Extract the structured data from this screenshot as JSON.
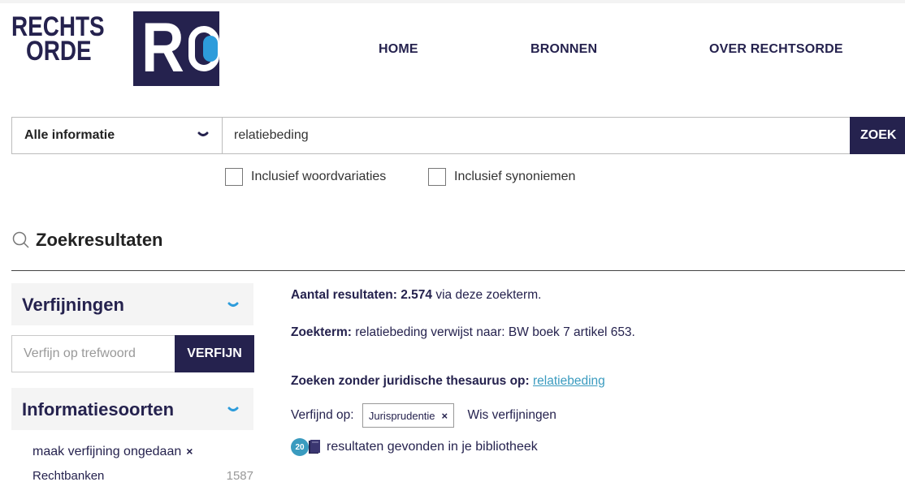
{
  "logo": {
    "line1": "RECHTS",
    "line2": "ORDE",
    "mark": "R"
  },
  "nav": {
    "home": "HOME",
    "bronnen": "BRONNEN",
    "over": "OVER RECHTSORDE"
  },
  "search": {
    "scope": "Alle informatie",
    "query": "relatiebeding",
    "submit": "ZOEK",
    "options": [
      {
        "label": "Inclusief woordvariaties",
        "checked": false
      },
      {
        "label": "Inclusief synoniemen",
        "checked": false
      }
    ]
  },
  "results": {
    "title": "Zoekresultaten",
    "count_label": "Aantal resultaten:",
    "count_value": "2.574",
    "count_suffix": " via deze zoekterm.",
    "term_label": "Zoekterm:",
    "term_text": " relatiebeding verwijst naar: BW boek 7 artikel 653.",
    "thesaurus_label": "Zoeken zonder juridische thesaurus op:",
    "thesaurus_link": "relatiebeding",
    "refined_label": "Verfijnd op:",
    "refined_chip": "Jurisprudentie",
    "chip_remove": "×",
    "clear_refinements": "Wis verfijningen",
    "library_count": "20",
    "library_text": "resultaten gevonden in je bibliotheek"
  },
  "sidebar": {
    "refinements_title": "Verfijningen",
    "refine_placeholder": "Verfijn op trefwoord",
    "refine_button": "VERFIJN",
    "info_types_title": "Informatiesoorten",
    "undo_label": "maak verfijning ongedaan",
    "undo_x": "×",
    "facets": [
      {
        "label": "Rechtbanken",
        "count": "1587"
      }
    ]
  },
  "colors": {
    "brand": "#25224e",
    "accent": "#2d9cdb",
    "link": "#3a9bbf"
  }
}
